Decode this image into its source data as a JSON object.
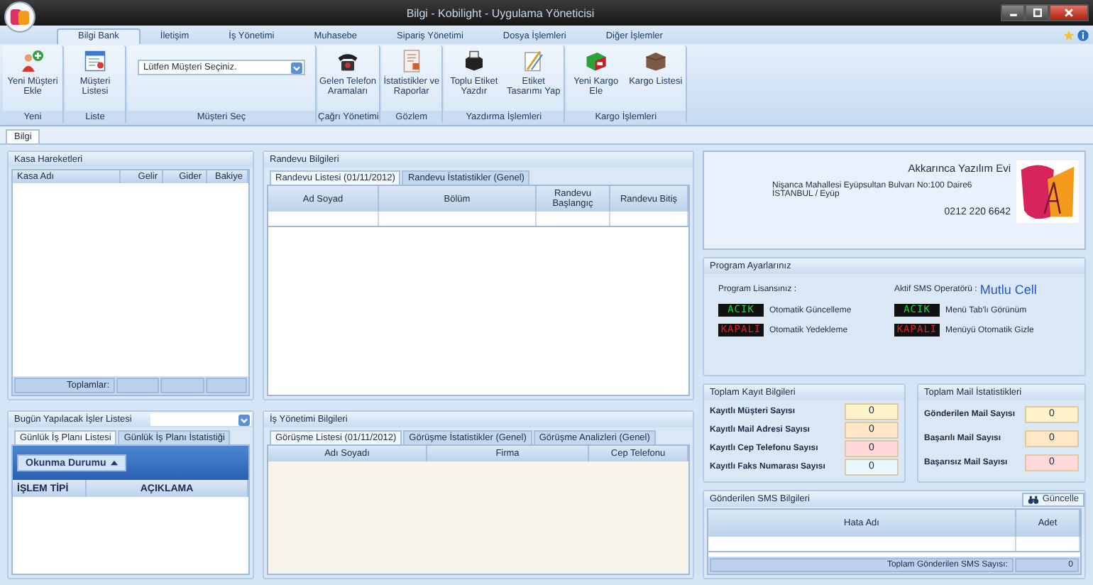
{
  "window": {
    "title": "Bilgi - Kobilight - Uygulama Yöneticisi"
  },
  "ribbon_tabs": [
    {
      "label": "Bilgi Bank",
      "selected": true
    },
    {
      "label": "İletişim",
      "selected": false
    },
    {
      "label": "İş Yönetimi",
      "selected": false
    },
    {
      "label": "Muhasebe",
      "selected": false
    },
    {
      "label": "Sipariş Yönetimi",
      "selected": false
    },
    {
      "label": "Dosya İşlemleri",
      "selected": false
    },
    {
      "label": "Diğer İşlemler",
      "selected": false
    }
  ],
  "ribbon_groups": [
    {
      "label": "Yeni",
      "buttons": [
        "Yeni Müşteri Ekle"
      ]
    },
    {
      "label": "Liste",
      "buttons": [
        "Müşteri Listesi"
      ]
    },
    {
      "label": "Müşteri Seç",
      "select": "Lütfen Müşteri Seçiniz."
    },
    {
      "label": "Çağrı Yönetimi",
      "buttons": [
        "Gelen Telefon Aramaları"
      ]
    },
    {
      "label": "Gözlem",
      "buttons": [
        "İstatistikler ve Raporlar"
      ]
    },
    {
      "label": "Yazdırma İşlemleri",
      "buttons": [
        "Toplu Etiket Yazdır",
        "Etiket Tasarımı Yap"
      ]
    },
    {
      "label": "Kargo İşlemleri",
      "buttons": [
        "Yeni Kargo Ele",
        "Kargo Listesi"
      ]
    }
  ],
  "document_tabs": [
    {
      "label": "Bilgi",
      "selected": true
    }
  ],
  "kasa": {
    "title": "Kasa Hareketleri",
    "columns": [
      "Kasa Adı",
      "Gelir",
      "Gider",
      "Bakiye"
    ],
    "footer_label": "Toplamlar:"
  },
  "randevu": {
    "title": "Randevu Bilgileri",
    "tabs": [
      {
        "label": "Randevu Listesi (01/11/2012)",
        "selected": true
      },
      {
        "label": "Randevu İstatistikler (Genel)",
        "selected": false
      }
    ],
    "columns": [
      "Ad Soyad",
      "Bölüm",
      "Randevu Başlangıç",
      "Randevu Bitiş"
    ]
  },
  "gorev": {
    "title": "Bugün Yapılacak İşler Listesi",
    "tabs": [
      {
        "label": "Günlük İş Planı Listesi",
        "selected": true
      },
      {
        "label": "Günlük İş Planı İstatistiği",
        "selected": false
      }
    ],
    "group_button": "Okunma Durumu",
    "columns": [
      "İŞLEM TİPİ",
      "AÇIKLAMA"
    ]
  },
  "is_yonetimi": {
    "title": "İş Yönetimi Bilgileri",
    "tabs": [
      {
        "label": "Görüşme Listesi (01/11/2012)",
        "selected": true
      },
      {
        "label": "Görüşme İstatistikler (Genel)",
        "selected": false
      },
      {
        "label": "Görüşme Analizleri (Genel)",
        "selected": false
      }
    ],
    "columns": [
      "Adı Soyadı",
      "Firma",
      "Cep Telefonu"
    ]
  },
  "company": {
    "name": "Akkarınca Yazılım Evi",
    "address": "Nişanca Mahallesi Eyüpsultan Bulvarı No:100 Daire6 İSTANBUL / Eyüp",
    "phone": "0212 220 6642"
  },
  "program": {
    "title": "Program Ayarlarınız",
    "license_label": "Program Lisansınız :",
    "sms_label": "Aktif SMS Operatörü :",
    "sms_operator": "Mutlu Cell",
    "settings": [
      {
        "status": "ACIK",
        "on": true,
        "label": "Otomatik Güncelleme"
      },
      {
        "status": "ACIK",
        "on": true,
        "label": "Menü Tab'lı Görünüm"
      },
      {
        "status": "KAPALI",
        "on": false,
        "label": "Otomatik Yedekleme"
      },
      {
        "status": "KAPALI",
        "on": false,
        "label": "Menüyü Otomatik Gizle"
      }
    ]
  },
  "kayit": {
    "title": "Toplam Kayıt Bilgileri",
    "rows": [
      {
        "label": "Kayıtlı Müşteri Sayısı",
        "value": "0",
        "color": "#fff3cc"
      },
      {
        "label": "Kayıtlı Mail Adresi Sayısı",
        "value": "0",
        "color": "#ffe6c4"
      },
      {
        "label": "Kayıtlı Cep Telefonu Sayısı",
        "value": "0",
        "color": "#ffd9d9"
      },
      {
        "label": "Kayıtlı Faks Numarası Sayısı",
        "value": "0",
        "color": "#eaf8ff"
      }
    ]
  },
  "mail": {
    "title": "Toplam Mail İstatistikleri",
    "rows": [
      {
        "label": "Gönderilen Mail Sayısı",
        "value": "0",
        "color": "#fff3cc"
      },
      {
        "label": "Başarılı Mail Sayısı",
        "value": "0",
        "color": "#ffe6c4"
      },
      {
        "label": "Başarısız Mail Sayısı",
        "value": "0",
        "color": "#ffd9d9"
      }
    ]
  },
  "sms": {
    "title": "Gönderilen SMS Bilgileri",
    "button": "Güncelle",
    "columns": [
      "Hata Adı",
      "Adet"
    ],
    "total_label": "Toplam Gönderilen SMS Sayısı:",
    "total": "0"
  }
}
